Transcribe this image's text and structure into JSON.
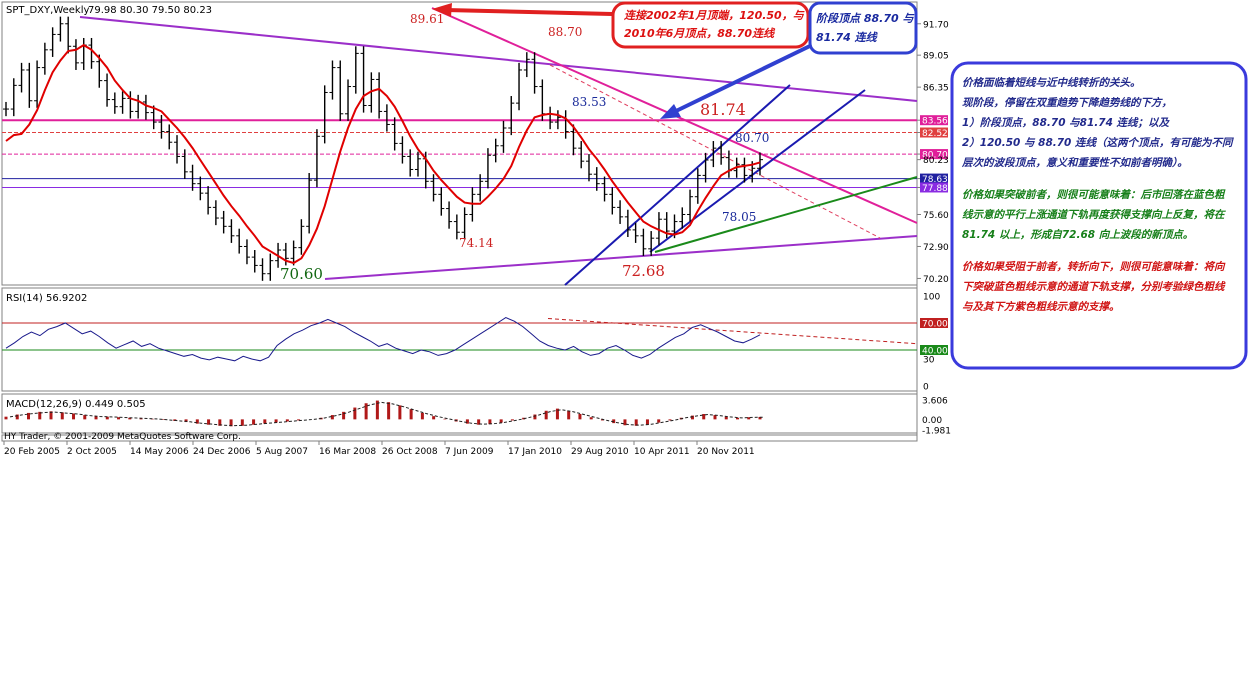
{
  "chart_data": [
    {
      "type": "line",
      "panel": "price",
      "symbol_title": "SPT_DXY,Weekly",
      "ohlc": "79.98 80.30 79.50 80.23",
      "y_axis_labels": [
        "91.70",
        "89.05",
        "86.35",
        "83.56",
        "82.52",
        "80.70",
        "80.23",
        "78.63",
        "77.88",
        "75.60",
        "72.90",
        "70.20"
      ],
      "ylim": [
        69.9,
        93.2
      ],
      "x_ticks": [
        "20 Feb 2005",
        "2 Oct 2005",
        "14 May 2006",
        "24 Dec 2006",
        "5 Aug 2007",
        "16 Mar 2008",
        "26 Oct 2008",
        "7 Jun 2009",
        "17 Jan 2010",
        "29 Aug 2010",
        "10 Apr 2011",
        "20 Nov 2011"
      ],
      "close_series": [
        84.5,
        86.5,
        87.8,
        85.2,
        88.0,
        89.5,
        90.8,
        91.7,
        89.8,
        88.4,
        89.9,
        88.5,
        86.9,
        85.3,
        84.7,
        85.4,
        84.3,
        85.1,
        84.2,
        83.4,
        82.6,
        81.7,
        80.5,
        79.2,
        78.2,
        77.4,
        76.2,
        75.3,
        74.6,
        73.8,
        72.9,
        72.0,
        71.3,
        70.6,
        71.7,
        72.6,
        71.9,
        72.8,
        74.6,
        78.5,
        82.2,
        85.9,
        88.0,
        84.1,
        86.4,
        89.2,
        84.8,
        87.0,
        84.3,
        83.2,
        81.6,
        80.5,
        79.4,
        80.3,
        78.4,
        77.3,
        76.1,
        75.0,
        74.1,
        75.6,
        77.3,
        78.4,
        80.6,
        81.4,
        82.9,
        85.0,
        87.8,
        88.7,
        86.4,
        84.1,
        83.4,
        83.8,
        82.6,
        81.2,
        80.1,
        79.0,
        78.2,
        77.3,
        76.2,
        75.4,
        74.3,
        73.8,
        72.7,
        73.6,
        75.2,
        74.2,
        75.0,
        75.6,
        77.1,
        78.9,
        80.2,
        81.2,
        80.4,
        79.3,
        79.8,
        78.9,
        79.5,
        80.23
      ],
      "ma_series": [
        81.8,
        82.3,
        82.4,
        83.2,
        84.4,
        86.1,
        87.6,
        88.6,
        89.4,
        89.5,
        89.9,
        89.5,
        88.8,
        88.0,
        86.9,
        86.1,
        85.4,
        85.2,
        84.8,
        84.6,
        84.3,
        83.6,
        82.9,
        82.1,
        81.2,
        80.2,
        79.2,
        78.2,
        77.2,
        76.3,
        75.5,
        74.6,
        73.8,
        72.9,
        72.5,
        72.1,
        71.7,
        71.5,
        71.9,
        73.0,
        74.4,
        76.3,
        78.6,
        80.9,
        82.9,
        84.5,
        85.6,
        86.0,
        86.2,
        85.6,
        84.7,
        83.5,
        82.2,
        81.1,
        80.3,
        79.3,
        78.5,
        77.8,
        77.1,
        76.6,
        76.5,
        76.5,
        77.1,
        77.8,
        78.6,
        79.7,
        81.3,
        82.7,
        83.8,
        84.0,
        84.1,
        84.0,
        83.7,
        83.0,
        82.1,
        81.1,
        80.3,
        79.4,
        78.4,
        77.5,
        76.6,
        75.8,
        75.0,
        74.6,
        74.3,
        74.0,
        73.9,
        74.1,
        74.7,
        75.9,
        77.0,
        78.0,
        78.9,
        79.3,
        79.6,
        79.7,
        79.8,
        80.0
      ],
      "annotations": [
        "89.61",
        "88.70",
        "83.53",
        "81.74",
        "80.70",
        "78.05",
        "74.14",
        "70.60",
        "72.68"
      ],
      "horizontal_levels": [
        83.56,
        82.52,
        80.7,
        78.63,
        77.88
      ],
      "x_range_weeks": [
        0,
        360
      ]
    },
    {
      "type": "line",
      "panel": "rsi",
      "title": "RSI(14) 56.9202",
      "y_axis_labels": [
        "100",
        "70.00",
        "40.00",
        "30",
        "0"
      ],
      "levels": [
        70,
        40
      ],
      "ylim": [
        0,
        100
      ],
      "values": [
        42,
        48,
        55,
        60,
        56,
        63,
        66,
        70,
        64,
        58,
        61,
        55,
        48,
        42,
        46,
        50,
        44,
        47,
        42,
        39,
        36,
        33,
        35,
        31,
        29,
        32,
        30,
        28,
        33,
        30,
        28,
        32,
        45,
        52,
        58,
        62,
        67,
        70,
        74,
        70,
        66,
        60,
        55,
        50,
        44,
        47,
        42,
        39,
        36,
        40,
        38,
        34,
        36,
        40,
        46,
        52,
        58,
        64,
        70,
        76,
        72,
        66,
        58,
        50,
        45,
        42,
        40,
        44,
        38,
        34,
        36,
        42,
        45,
        40,
        34,
        31,
        35,
        42,
        48,
        54,
        58,
        65,
        68,
        64,
        60,
        55,
        50,
        48,
        52,
        56.92
      ]
    },
    {
      "type": "bar",
      "panel": "macd",
      "title": "MACD(12,26,9) 0.449 0.505",
      "y_axis_labels": [
        "3.606",
        "0.00",
        "-1.981"
      ],
      "ylim": [
        -1.981,
        3.606
      ],
      "values": [
        0.5,
        0.9,
        1.2,
        1.4,
        1.5,
        1.3,
        1.1,
        0.8,
        0.6,
        0.5,
        0.4,
        0.3,
        0.2,
        0.1,
        -0.1,
        -0.3,
        -0.5,
        -0.8,
        -1.0,
        -1.2,
        -1.3,
        -1.2,
        -1.0,
        -0.8,
        -0.6,
        -0.4,
        -0.2,
        0.0,
        0.3,
        0.8,
        1.4,
        2.2,
        3.0,
        3.5,
        3.2,
        2.6,
        1.9,
        1.2,
        0.6,
        0.1,
        -0.4,
        -0.8,
        -1.0,
        -0.9,
        -0.6,
        -0.2,
        0.3,
        0.9,
        1.6,
        2.0,
        1.6,
        1.0,
        0.4,
        -0.2,
        -0.7,
        -1.1,
        -1.2,
        -1.0,
        -0.6,
        -0.2,
        0.3,
        0.7,
        1.0,
        0.8,
        0.5,
        0.3,
        0.4,
        0.449
      ]
    }
  ],
  "callouts": {
    "red_box": [
      "连接2002年1月顶端，120.50，与",
      "2010年6月顶点，88.70连线"
    ],
    "blue_box": [
      "阶段顶点 88.70 与",
      "81.74 连线"
    ]
  },
  "notes_panel": {
    "para1": [
      "价格面临着短线与近中线转折的关头。",
      "现阶段，停留在双重趋势下降趋势线的下方，",
      "1）阶段顶点，88.70 与81.74 连线；以及",
      "2）120.50 与 88.70 连线（这两个顶点，有可能为不同",
      "层次的波段顶点，意义和重要性不如前者明确）。"
    ],
    "para2": [
      "价格如果突破前者，则很可能意味着：后市回落在蓝色粗",
      "线示意的平行上涨通道下轨再度获得支撑向上反复，将在",
      "81.74 以上，形成自72.68 向上波段的新顶点。"
    ],
    "para3": [
      "价格如果受阻于前者，转折向下，则很可能意味着：将向",
      "下突破蓝色粗线示意的通道下轨支撑，分别考验绿色粗线",
      "与及其下方紫色粗线示意的支撑。"
    ]
  },
  "copyright": "HY Trader, © 2001-2009 MetaQuotes Software Corp.",
  "colors": {
    "candle": "#000000",
    "ma": "#e00000",
    "purple_line": "#9b2fc9",
    "magenta_line": "#e0209a",
    "blue_channel": "#1a1ab0",
    "green_line": "#1a8a1a",
    "grid": "#aaaaaa",
    "notes_border": "#3a3adc",
    "notes_para1": "#222a8c",
    "notes_para2": "#17801a",
    "notes_para3": "#d01515"
  }
}
